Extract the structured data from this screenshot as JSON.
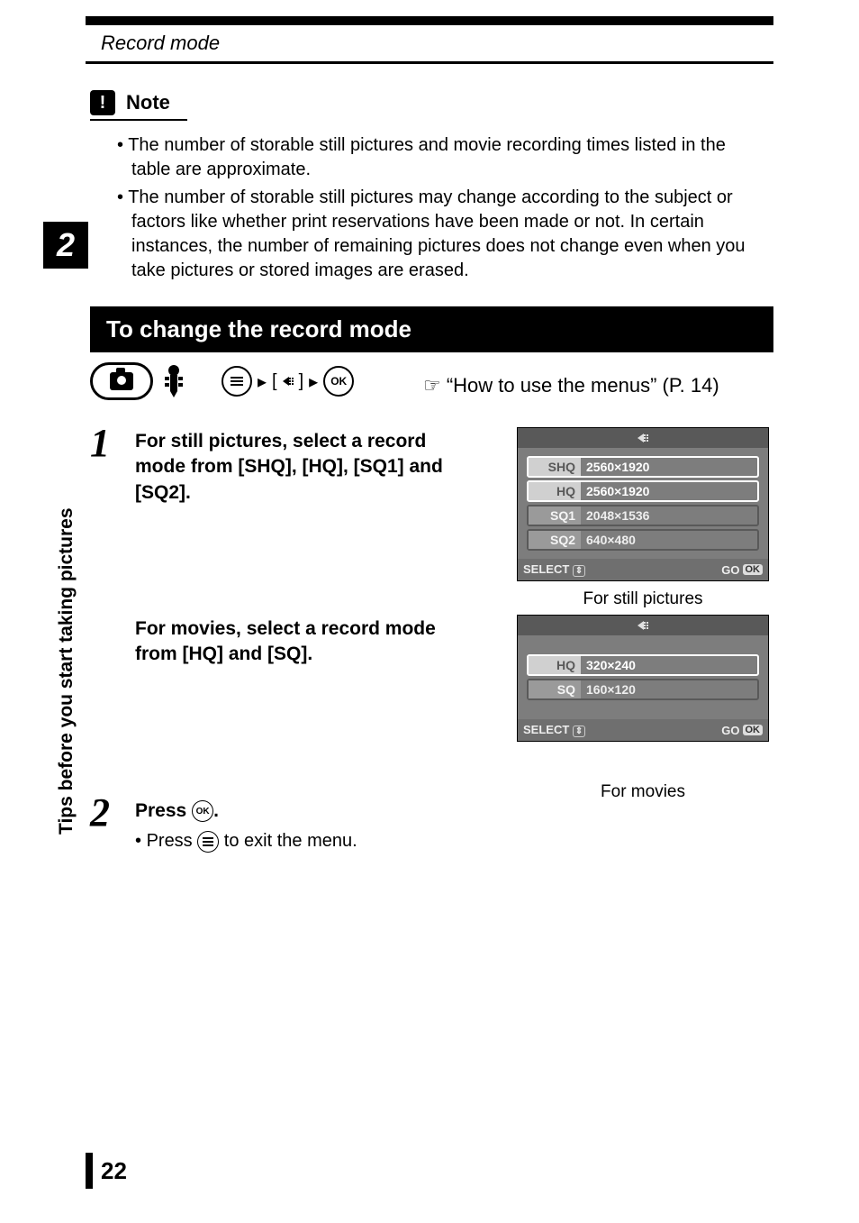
{
  "header": {
    "section": "Record mode"
  },
  "note": {
    "label": "Note",
    "bullets": [
      "The number of storable still pictures and movie recording times listed in the table are approximate.",
      "The number of storable still pictures may change according to the subject or factors like whether print reservations have been made or not. In certain instances, the number of remaining pictures does not change even when you take pictures or stored images are erased."
    ]
  },
  "sidebar": {
    "chapter": "2",
    "title": "Tips before you start taking pictures"
  },
  "section_bar": "To change the record mode",
  "menu_sequence": {
    "bracket": "[",
    "bracket_close": "]"
  },
  "see_also": "“How to use the menus” (P. 14)",
  "steps": {
    "s1": {
      "num": "1",
      "text": "For still pictures, select a record mode from [SHQ], [HQ], [SQ1] and [SQ2]."
    },
    "s1a": {
      "text": "For movies, select a record mode from [HQ] and [SQ]."
    },
    "s2": {
      "num": "2",
      "text_a": "Press ",
      "text_b": ".",
      "sub_a": "Press ",
      "sub_b": " to exit the menu.",
      "ok": "OK"
    }
  },
  "lcd_still": {
    "rows": [
      {
        "label": "SHQ",
        "value": "2560×1920",
        "selected": true
      },
      {
        "label": "HQ",
        "value": "2560×1920",
        "selected": false
      },
      {
        "label": "SQ1",
        "value": "2048×1536",
        "selected": false
      },
      {
        "label": "SQ2",
        "value": "640×480",
        "selected": false
      }
    ],
    "footer_left": "SELECT",
    "footer_go": "GO",
    "footer_ok": "OK",
    "caption": "For still pictures"
  },
  "lcd_movie": {
    "rows": [
      {
        "label": "HQ",
        "value": "320×240",
        "selected": true
      },
      {
        "label": "SQ",
        "value": "160×120",
        "selected": false
      }
    ],
    "footer_left": "SELECT",
    "footer_go": "GO",
    "footer_ok": "OK",
    "caption": "For movies"
  },
  "page_number": "22"
}
